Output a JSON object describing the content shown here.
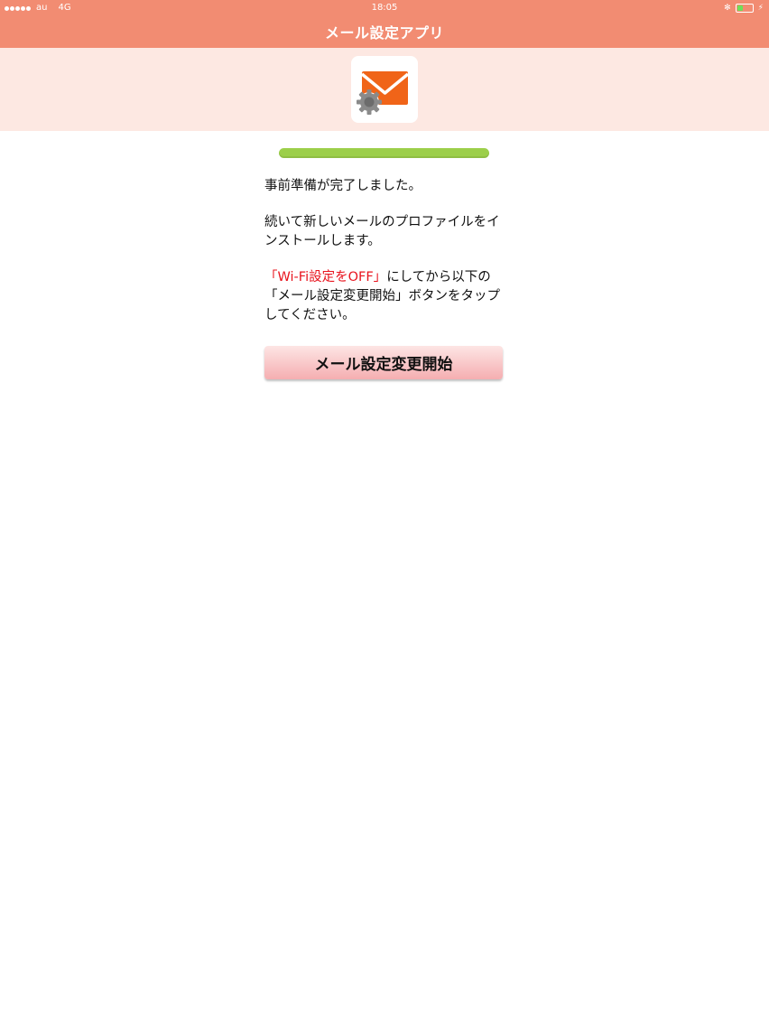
{
  "status_bar": {
    "carrier": "au",
    "network": "4G",
    "time": "18:05",
    "battery_level": 0.35
  },
  "nav": {
    "title": "メール設定アプリ"
  },
  "app_icon": {
    "icon": "mail-settings-icon",
    "envelope_color": "#f06418",
    "gear_color": "#8a8a8a"
  },
  "progress": {
    "value": 1.0,
    "color": "#9ccf4a"
  },
  "message": {
    "line1": "事前準備が完了しました。",
    "line2": "続いて新しいメールのプロファイルをインストールします。",
    "warning_highlight": "「Wi-Fi設定をOFF」",
    "line3_rest": "にしてから以下の「メール設定変更開始」ボタンをタップしてください。"
  },
  "button": {
    "label": "メール設定変更開始"
  },
  "colors": {
    "header": "#f28c72",
    "header_band": "#fde8e2",
    "warning": "#e8141e"
  }
}
